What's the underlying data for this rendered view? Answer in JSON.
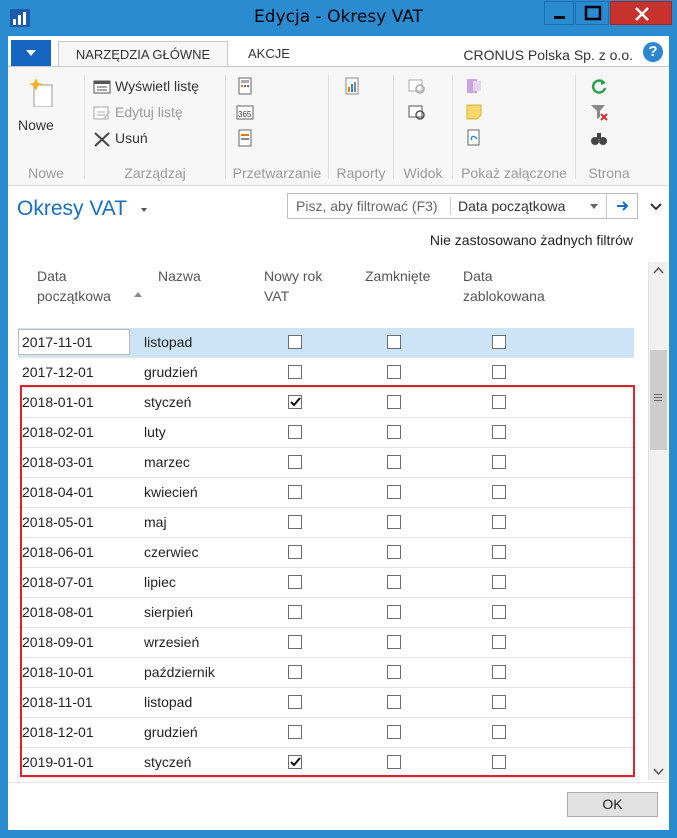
{
  "window": {
    "title": "Edycja - Okresy VAT"
  },
  "ribbon": {
    "tabs": [
      {
        "label": "NARZĘDZIA GŁÓWNE"
      },
      {
        "label": "AKCJE"
      }
    ],
    "company": "CRONUS Polska Sp. z o.o.",
    "help_label": "?",
    "groups": {
      "nowe": {
        "label": "Nowe",
        "new_button": "Nowe"
      },
      "zarzadzaj": {
        "label": "Zarządzaj",
        "view_list": "Wyświetl listę",
        "edit_list": "Edytuj listę",
        "delete": "Usuń"
      },
      "przetwarzanie": {
        "label": "Przetwarzanie"
      },
      "raporty": {
        "label": "Raporty"
      },
      "widok": {
        "label": "Widok"
      },
      "pokaz": {
        "label": "Pokaż załączone"
      },
      "strona": {
        "label": "Strona"
      }
    }
  },
  "page": {
    "title": "Okresy VAT",
    "filter": {
      "placeholder": "Pisz, aby filtrować (F3)",
      "field": "Data początkowa"
    },
    "no_filters": "Nie zastosowano żadnych filtrów"
  },
  "grid": {
    "headers": {
      "date_line1": "Data",
      "date_line2": "początkowa",
      "name": "Nazwa",
      "new_year_line1": "Nowy rok",
      "new_year_line2": "VAT",
      "closed": "Zamknięte",
      "locked_line1": "Data",
      "locked_line2": "zablokowana"
    },
    "rows": [
      {
        "date": "2017-11-01",
        "name": "listopad",
        "new_year": false,
        "closed": false,
        "locked": false,
        "selected": true
      },
      {
        "date": "2017-12-01",
        "name": "grudzień",
        "new_year": false,
        "closed": false,
        "locked": false
      },
      {
        "date": "2018-01-01",
        "name": "styczeń",
        "new_year": true,
        "closed": false,
        "locked": false
      },
      {
        "date": "2018-02-01",
        "name": "luty",
        "new_year": false,
        "closed": false,
        "locked": false
      },
      {
        "date": "2018-03-01",
        "name": "marzec",
        "new_year": false,
        "closed": false,
        "locked": false
      },
      {
        "date": "2018-04-01",
        "name": "kwiecień",
        "new_year": false,
        "closed": false,
        "locked": false
      },
      {
        "date": "2018-05-01",
        "name": "maj",
        "new_year": false,
        "closed": false,
        "locked": false
      },
      {
        "date": "2018-06-01",
        "name": "czerwiec",
        "new_year": false,
        "closed": false,
        "locked": false
      },
      {
        "date": "2018-07-01",
        "name": "lipiec",
        "new_year": false,
        "closed": false,
        "locked": false
      },
      {
        "date": "2018-08-01",
        "name": "sierpień",
        "new_year": false,
        "closed": false,
        "locked": false
      },
      {
        "date": "2018-09-01",
        "name": "wrzesień",
        "new_year": false,
        "closed": false,
        "locked": false
      },
      {
        "date": "2018-10-01",
        "name": "październik",
        "new_year": false,
        "closed": false,
        "locked": false
      },
      {
        "date": "2018-11-01",
        "name": "listopad",
        "new_year": false,
        "closed": false,
        "locked": false
      },
      {
        "date": "2018-12-01",
        "name": "grudzień",
        "new_year": false,
        "closed": false,
        "locked": false
      },
      {
        "date": "2019-01-01",
        "name": "styczeń",
        "new_year": true,
        "closed": false,
        "locked": false
      }
    ]
  },
  "footer": {
    "ok_label": "OK"
  },
  "colors": {
    "titlebar": "#2a8bd0",
    "close_button": "#c7332c",
    "accent": "#1a6fb8",
    "selected_row": "#cde4f7",
    "highlight_border": "#d9232e"
  }
}
